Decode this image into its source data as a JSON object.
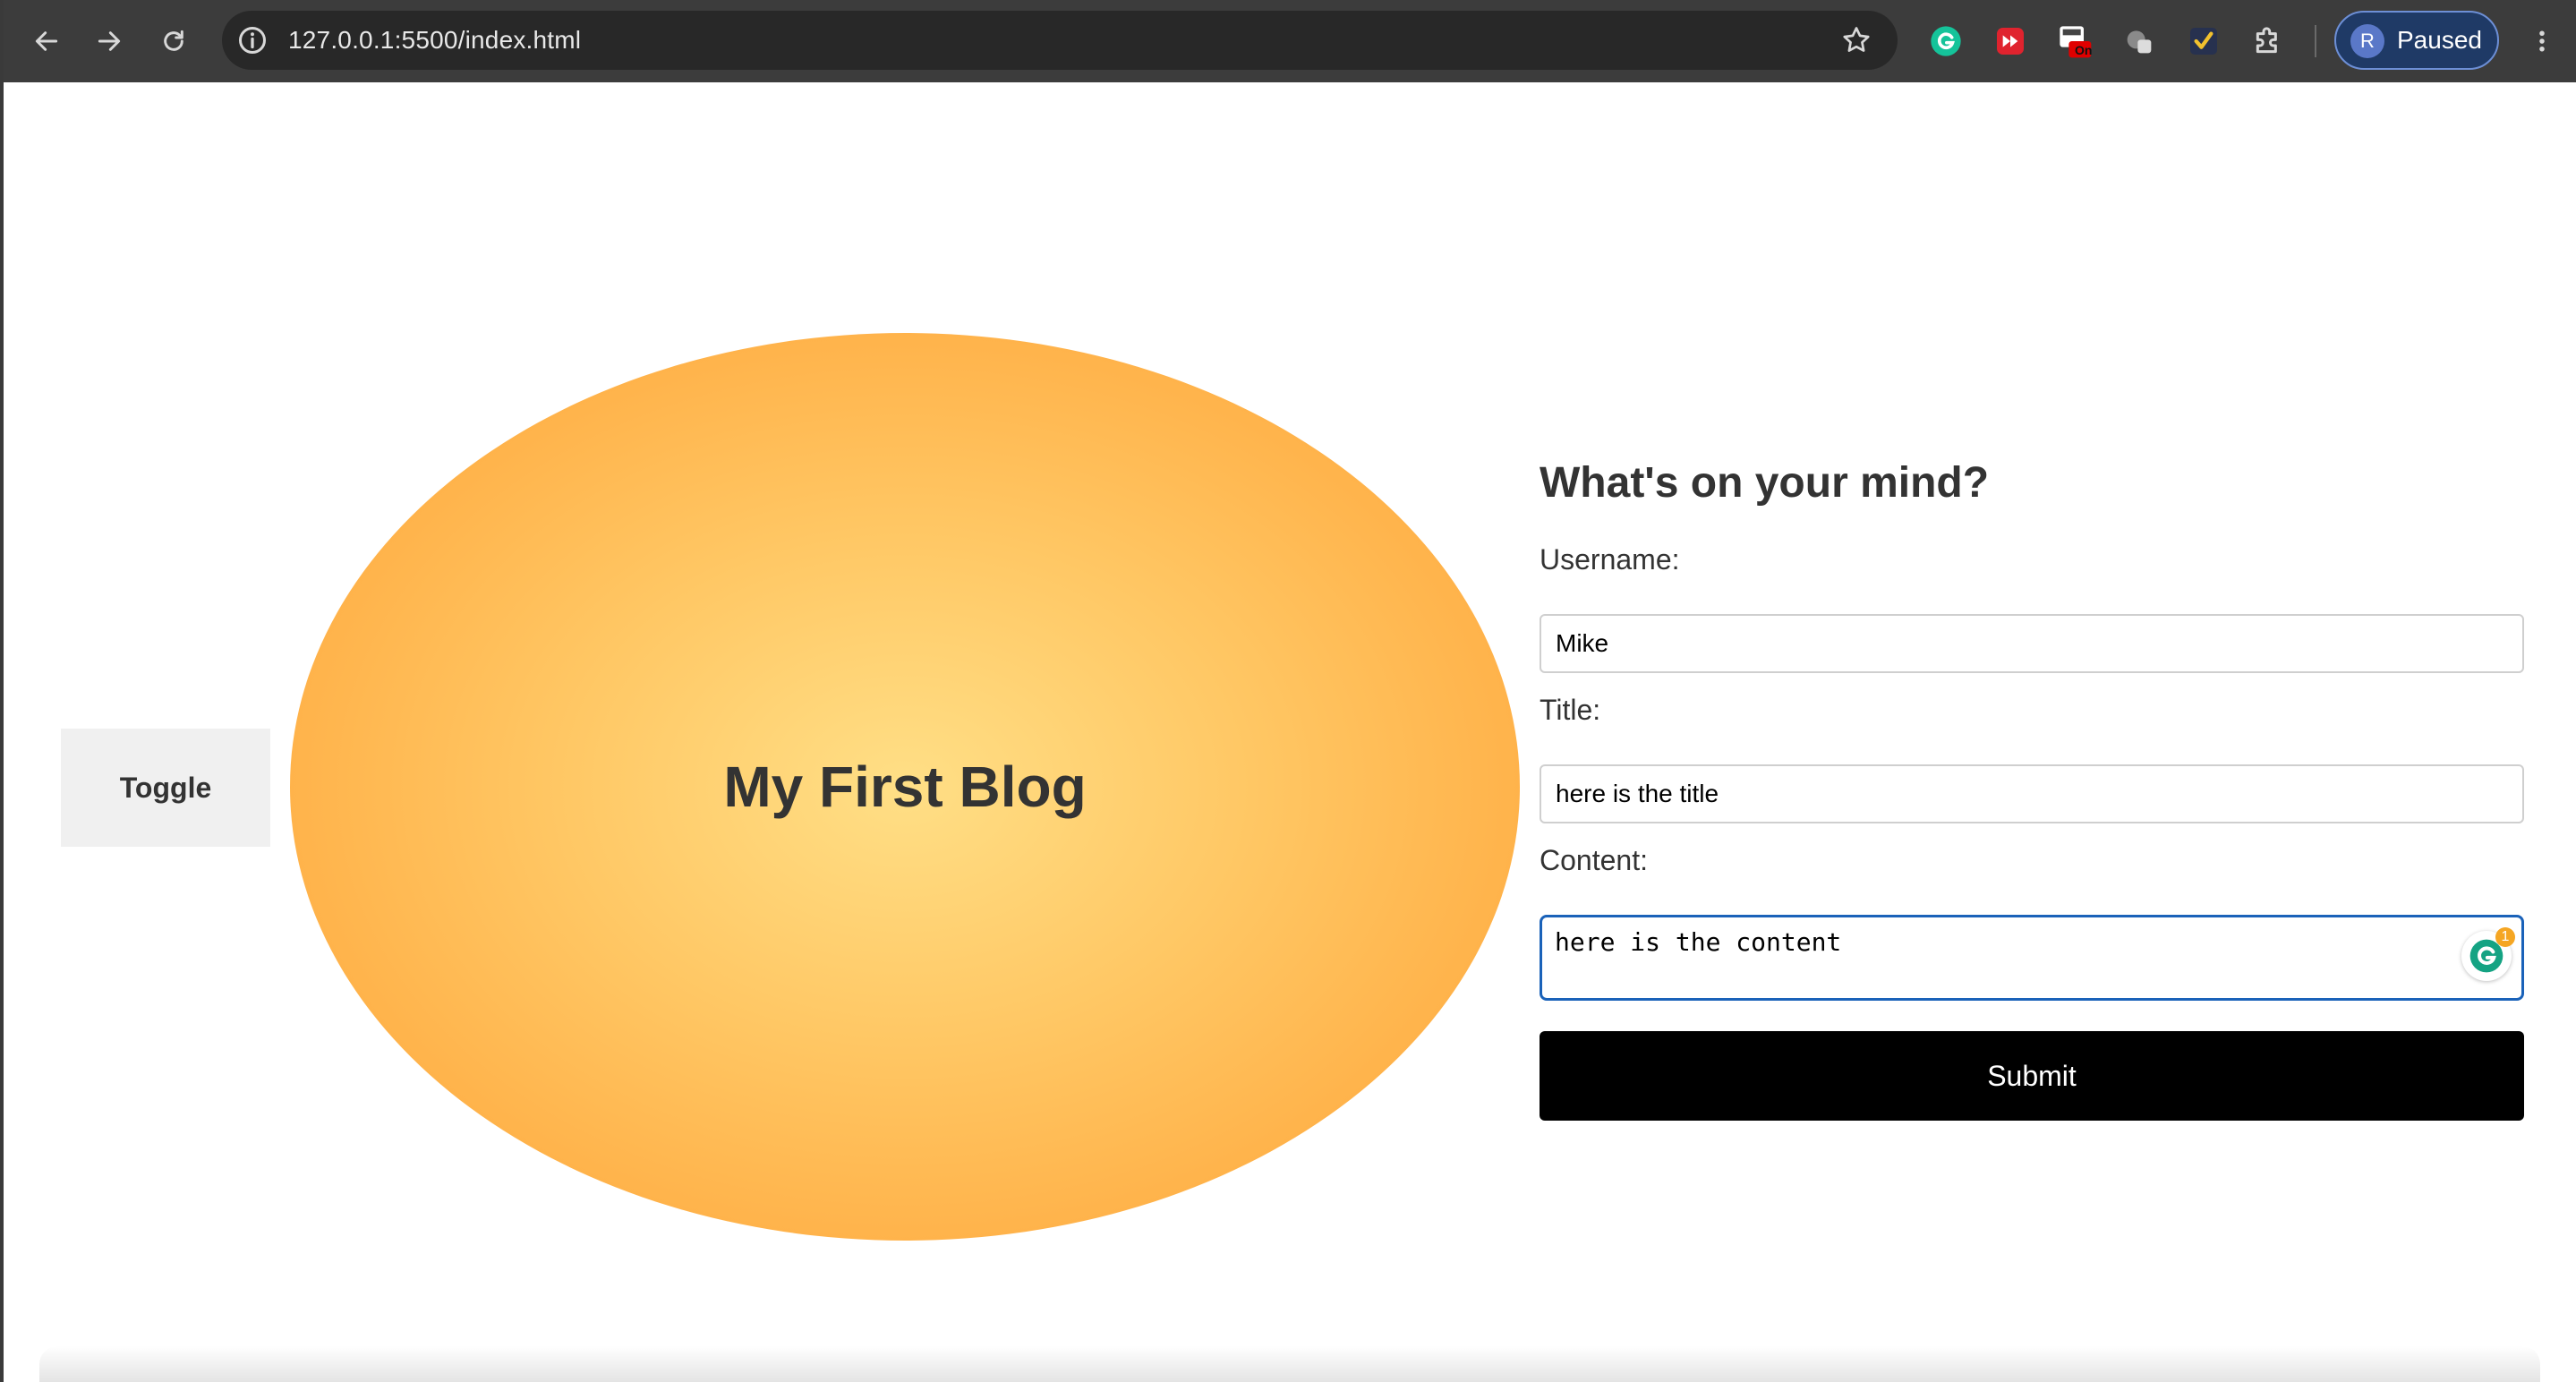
{
  "browser": {
    "url": "127.0.0.1:5500/index.html",
    "profile": {
      "initial": "R",
      "status": "Paused"
    },
    "extensions": {
      "badge_text": "On"
    }
  },
  "page": {
    "toggle_label": "Toggle",
    "blog_title": "My First Blog",
    "form": {
      "heading": "What's on your mind?",
      "username_label": "Username:",
      "username_value": "Mike",
      "title_label": "Title:",
      "title_value": "here is the title",
      "content_label": "Content:",
      "content_value": "here is the content",
      "grammarly_count": "1",
      "submit_label": "Submit"
    }
  },
  "colors": {
    "chrome_bg": "#3c3c3c",
    "omnibox_bg": "#282828",
    "ellipse_center": "#ffdf86",
    "ellipse_edge": "#ffa033",
    "submit_bg": "#000000",
    "focus_border": "#1a62b9"
  },
  "icons": [
    "back-arrow-icon",
    "forward-arrow-icon",
    "reload-icon",
    "info-icon",
    "star-icon",
    "grammarly-extension-icon",
    "media-extension-icon",
    "on-badge-extension-icon",
    "incognito-extension-icon",
    "checkmark-extension-icon",
    "puzzle-icon",
    "kebab-menu-icon",
    "grammarly-icon"
  ]
}
